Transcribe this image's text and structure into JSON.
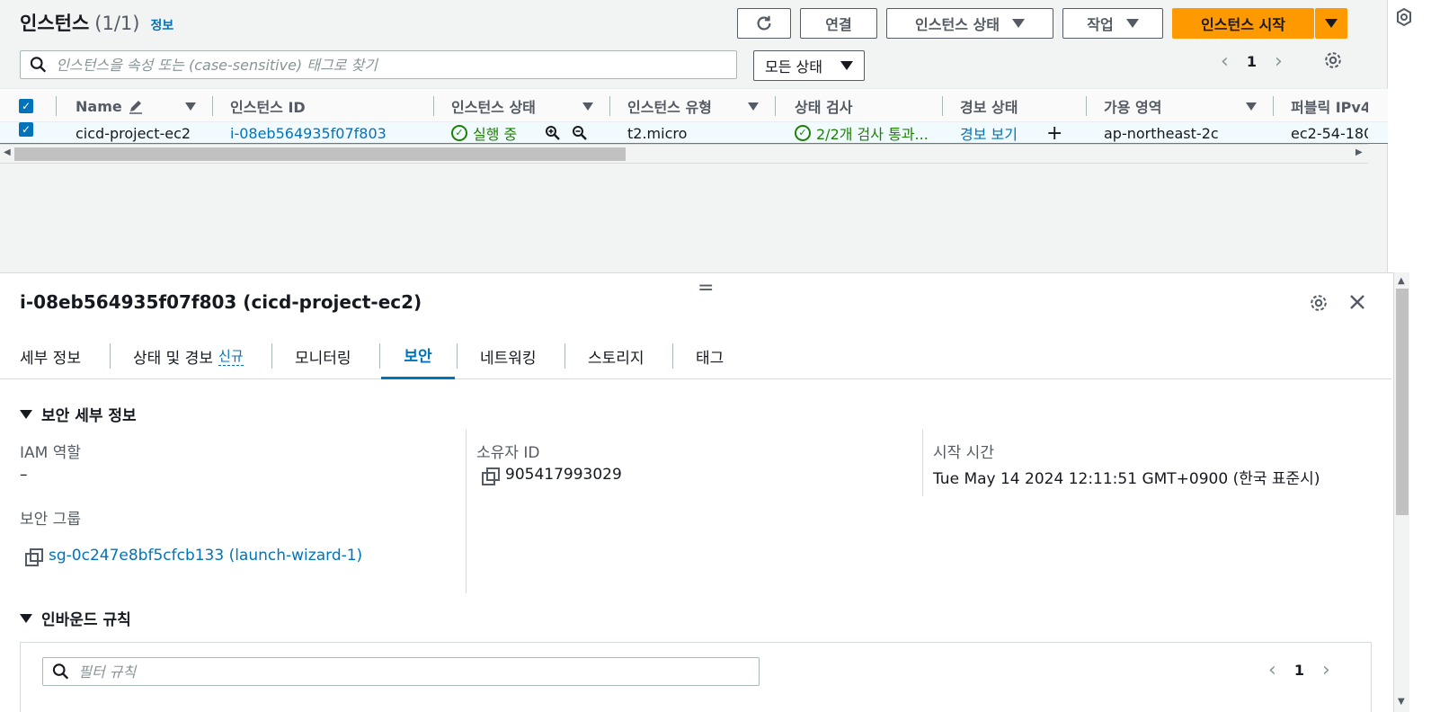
{
  "header": {
    "title": "인스턴스",
    "count": "(1/1)",
    "info_link": "정보"
  },
  "toolbar": {
    "refresh_icon": "refresh-icon",
    "connect": "연결",
    "instance_state": "인스턴스 상태",
    "actions": "작업",
    "launch": "인스턴스 시작"
  },
  "search": {
    "placeholder": "인스턴스을 속성 또는 (case-sensitive) 태그로 찾기"
  },
  "state_filter": {
    "value": "모든 상태"
  },
  "pagination": {
    "page": "1"
  },
  "table": {
    "columns": [
      "Name",
      "인스턴스 ID",
      "인스턴스 상태",
      "인스턴스 유형",
      "상태 검사",
      "경보 상태",
      "가용 영역",
      "퍼블릭 IPv4"
    ],
    "row": {
      "name": "cicd-project-ec2",
      "instance_id": "i-08eb564935f07f803",
      "state": "실행 중",
      "type": "t2.micro",
      "status_check": "2/2개 검사 통과...",
      "alarm": "경보 보기",
      "az": "ap-northeast-2c",
      "public_dns": "ec2-54-180"
    }
  },
  "split": {
    "title": "i-08eb564935f07f803 (cicd-project-ec2)",
    "tabs": [
      {
        "label": "세부 정보"
      },
      {
        "label": "상태 및 경보",
        "badge": "신규"
      },
      {
        "label": "모니터링"
      },
      {
        "label": "보안"
      },
      {
        "label": "네트워킹"
      },
      {
        "label": "스토리지"
      },
      {
        "label": "태그"
      }
    ],
    "active_tab": "보안",
    "security_details": {
      "heading": "보안 세부 정보",
      "iam_role_label": "IAM 역할",
      "iam_role_value": "–",
      "owner_label": "소유자 ID",
      "owner_value": "905417993029",
      "launch_time_label": "시작 시간",
      "launch_time_value": "Tue May 14 2024 12:11:51 GMT+0900 (한국 표준시)",
      "sg_label": "보안 그룹",
      "sg_value": "sg-0c247e8bf5cfcb133 (launch-wizard-1)"
    },
    "inbound": {
      "heading": "인바운드 규칙",
      "filter_placeholder": "필터 규칙",
      "page": "1"
    }
  },
  "colors": {
    "primary": "#ff9900",
    "link": "#0073bb",
    "success": "#1d8102"
  }
}
